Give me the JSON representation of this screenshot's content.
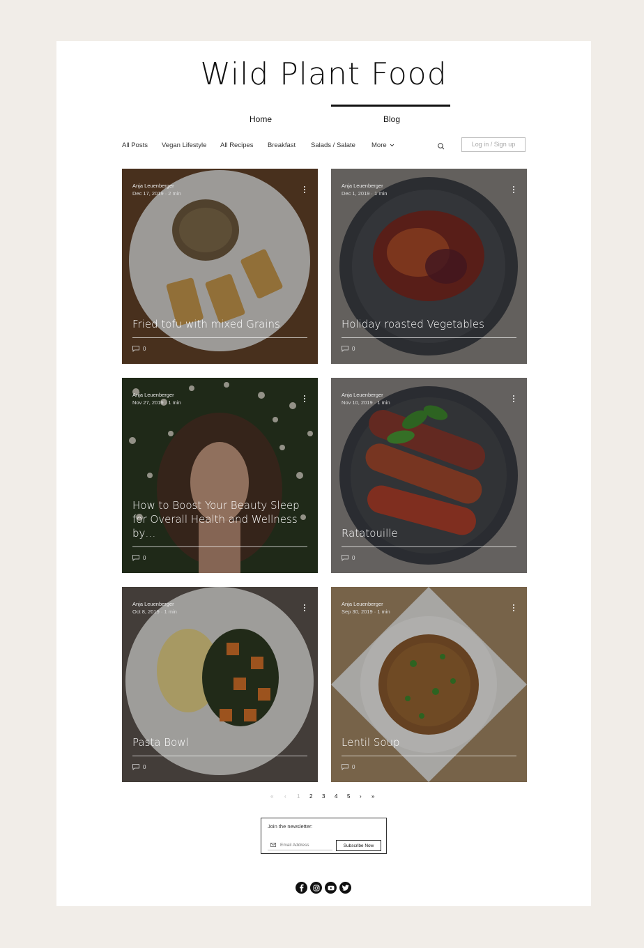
{
  "site": {
    "title": "Wild Plant Food"
  },
  "nav": {
    "items": [
      "Home",
      "Blog"
    ],
    "active": "Blog"
  },
  "categories": [
    "All Posts",
    "Vegan Lifestyle",
    "All Recipes",
    "Breakfast",
    "Salads / Salate",
    "More"
  ],
  "header": {
    "login_label": "Log in / Sign up",
    "search_icon": "search-icon"
  },
  "posts": [
    {
      "author": "Anja Leuenberger",
      "date": "Dec 17, 2019",
      "read": "2 min",
      "title": "Fried tofu with mixed Grains",
      "comments": "0"
    },
    {
      "author": "Anja Leuenberger",
      "date": "Dec 1, 2019",
      "read": "1 min",
      "title": "Holiday roasted Vegetables",
      "comments": "0"
    },
    {
      "author": "Anja Leuenberger",
      "date": "Nov 27, 2019",
      "read": "1 min",
      "title": "How to Boost Your Beauty Sleep for Overall Health and Wellness by…",
      "comments": "0"
    },
    {
      "author": "Anja Leuenberger",
      "date": "Nov 10, 2019",
      "read": "1 min",
      "title": "Ratatouille",
      "comments": "0"
    },
    {
      "author": "Anja Leuenberger",
      "date": "Oct 8, 2019",
      "read": "1 min",
      "title": "Pasta Bowl",
      "comments": "0"
    },
    {
      "author": "Anja Leuenberger",
      "date": "Sep 30, 2019",
      "read": "1 min",
      "title": "Lentil Soup",
      "comments": "0"
    }
  ],
  "pagination": {
    "first": "«",
    "prev": "‹",
    "pages": [
      "1",
      "2",
      "3",
      "4",
      "5"
    ],
    "current": "1",
    "next": "›",
    "last": "»"
  },
  "newsletter": {
    "label": "Join the newsletter:",
    "placeholder": "Email Address",
    "button": "Subscribe Now"
  },
  "social": [
    "facebook-icon",
    "instagram-icon",
    "youtube-icon",
    "twitter-icon"
  ],
  "colors": {
    "background": "#f1ede8",
    "page": "#ffffff",
    "text": "#111111"
  }
}
